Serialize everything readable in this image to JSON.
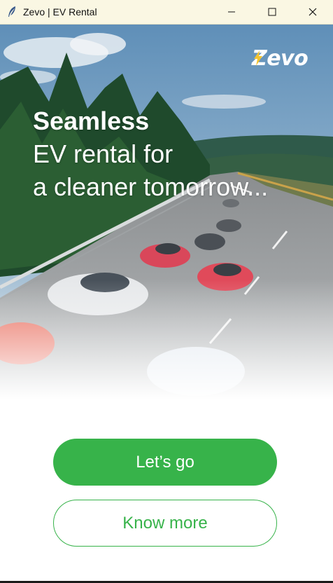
{
  "window": {
    "title": "Zevo | EV Rental",
    "app_icon": "feather-icon",
    "controls": [
      "minimize-icon",
      "maximize-icon",
      "close-icon"
    ]
  },
  "hero": {
    "logo_text": "Zevo",
    "headline_line1": "Seamless",
    "headline_line2": "EV rental for",
    "headline_line3": "a cleaner tomorrow..."
  },
  "actions": {
    "primary_label": "Let’s go",
    "secondary_label": "Know more"
  },
  "colors": {
    "accent": "#37b34a",
    "titlebar": "#faf7e3",
    "logo_bolt": "#f4c430"
  }
}
